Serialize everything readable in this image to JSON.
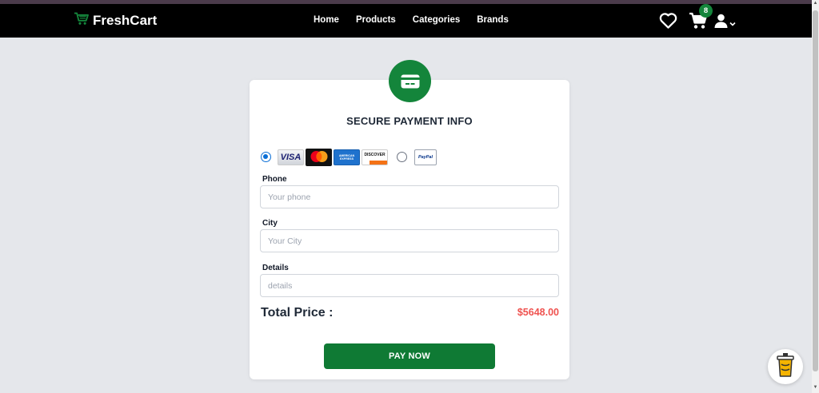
{
  "navbar": {
    "brand": "FreshCart",
    "links": [
      "Home",
      "Products",
      "Categories",
      "Brands"
    ],
    "cart_count": "8"
  },
  "payment": {
    "title": "SECURE PAYMENT INFO",
    "methods": [
      {
        "id": "card",
        "selected": true,
        "logos": [
          "VISA",
          "MasterCard",
          "AMERICAN EXPRESS",
          "DISCOVER"
        ]
      },
      {
        "id": "paypal",
        "selected": false,
        "logos": [
          "PayPal"
        ]
      }
    ]
  },
  "form": {
    "phone": {
      "label": "Phone",
      "placeholder": "Your phone",
      "value": ""
    },
    "city": {
      "label": "City",
      "placeholder": "Your City",
      "value": ""
    },
    "details": {
      "label": "Details",
      "placeholder": "details",
      "value": ""
    }
  },
  "summary": {
    "total_label": "Total Price :",
    "total_value": "$5648.00"
  },
  "actions": {
    "pay_now": "PAY NOW"
  },
  "colors": {
    "brand_green": "#14853b",
    "price_red": "#ef5350",
    "navbar": "#000000",
    "background": "#e5e7eb"
  },
  "icons": [
    "shopping-cart-brand-icon",
    "heart-icon",
    "cart-icon",
    "user-icon",
    "chevron-down-icon",
    "credit-card-icon",
    "chatbot-icon"
  ]
}
